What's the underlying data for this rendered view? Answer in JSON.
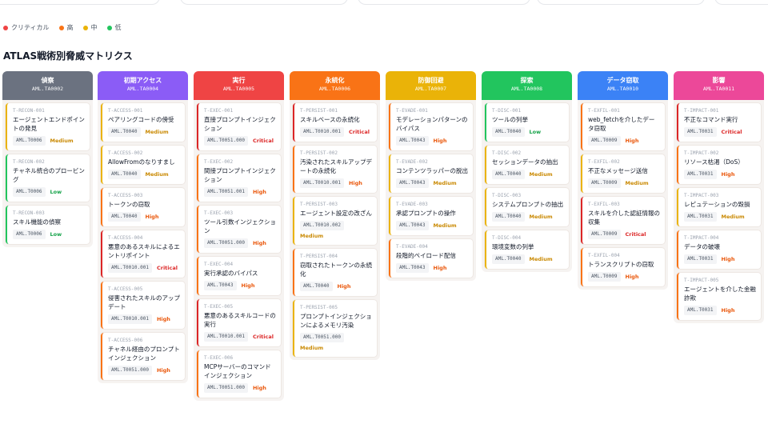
{
  "legend": [
    {
      "label": "クリティカル",
      "color": "#ef4444"
    },
    {
      "label": "高",
      "color": "#f97316"
    },
    {
      "label": "中",
      "color": "#eab308"
    },
    {
      "label": "低",
      "color": "#22c55e"
    }
  ],
  "title": "ATLAS戦術別脅威マトリクス",
  "severity_labels": {
    "critical": "Critical",
    "high": "High",
    "medium": "Medium",
    "low": "Low"
  },
  "severity_colors": {
    "critical": "#dc2626",
    "high": "#f97316",
    "medium": "#eab308",
    "low": "#22c55e"
  },
  "columns": [
    {
      "name": "偵察",
      "id": "AML.TA0002",
      "color": "#6b7280",
      "cards": [
        {
          "tid": "T-RECON-001",
          "name": "エージェントエンドポイントの発見",
          "aml": "AML.T0006",
          "sev": "medium"
        },
        {
          "tid": "T-RECON-002",
          "name": "チャネル統合のプロービング",
          "aml": "AML.T0006",
          "sev": "low"
        },
        {
          "tid": "T-RECON-003",
          "name": "スキル機能の偵察",
          "aml": "AML.T0006",
          "sev": "low"
        }
      ]
    },
    {
      "name": "初期アクセス",
      "id": "AML.TA0004",
      "color": "#8b5cf6",
      "cards": [
        {
          "tid": "T-ACCESS-001",
          "name": "ペアリングコードの傍受",
          "aml": "AML.T0040",
          "sev": "medium"
        },
        {
          "tid": "T-ACCESS-002",
          "name": "AllowFromのなりすまし",
          "aml": "AML.T0040",
          "sev": "medium"
        },
        {
          "tid": "T-ACCESS-003",
          "name": "トークンの窃取",
          "aml": "AML.T0040",
          "sev": "high"
        },
        {
          "tid": "T-ACCESS-004",
          "name": "悪意のあるスキルによるエントリポイント",
          "aml": "AML.T0010.001",
          "sev": "critical",
          "wrap": true
        },
        {
          "tid": "T-ACCESS-005",
          "name": "侵害されたスキルのアップデート",
          "aml": "AML.T0010.001",
          "sev": "high"
        },
        {
          "tid": "T-ACCESS-006",
          "name": "チャネル経由のプロンプトインジェクション",
          "aml": "AML.T0051.000",
          "sev": "high"
        }
      ]
    },
    {
      "name": "実行",
      "id": "AML.TA0005",
      "color": "#ef4444",
      "cards": [
        {
          "tid": "T-EXEC-001",
          "name": "直接プロンプトインジェクション",
          "aml": "AML.T0051.000",
          "sev": "critical",
          "wrap": true
        },
        {
          "tid": "T-EXEC-002",
          "name": "間接プロンプトインジェクション",
          "aml": "AML.T0051.001",
          "sev": "high"
        },
        {
          "tid": "T-EXEC-003",
          "name": "ツール引数インジェクション",
          "aml": "AML.T0051.000",
          "sev": "high"
        },
        {
          "tid": "T-EXEC-004",
          "name": "実行承認のバイパス",
          "aml": "AML.T0043",
          "sev": "high"
        },
        {
          "tid": "T-EXEC-005",
          "name": "悪意のあるスキルコードの実行",
          "aml": "AML.T0010.001",
          "sev": "critical",
          "wrap": true
        },
        {
          "tid": "T-EXEC-006",
          "name": "MCPサーバーのコマンドインジェクション",
          "aml": "AML.T0051.000",
          "sev": "high"
        }
      ]
    },
    {
      "name": "永続化",
      "id": "AML.TA0006",
      "color": "#f97316",
      "cards": [
        {
          "tid": "T-PERSIST-001",
          "name": "スキルベースの永続化",
          "aml": "AML.T0010.001",
          "sev": "critical",
          "wrap": true
        },
        {
          "tid": "T-PERSIST-002",
          "name": "汚染されたスキルアップデートの永続化",
          "aml": "AML.T0010.001",
          "sev": "high"
        },
        {
          "tid": "T-PERSIST-003",
          "name": "エージェント設定の改ざん",
          "aml": "AML.T0010.002",
          "sev": "medium",
          "wrap": true
        },
        {
          "tid": "T-PERSIST-004",
          "name": "窃取されたトークンの永続化",
          "aml": "AML.T0040",
          "sev": "high"
        },
        {
          "tid": "T-PERSIST-005",
          "name": "プロンプトインジェクションによるメモリ汚染",
          "aml": "AML.T0051.000",
          "sev": "medium",
          "wrap": true
        }
      ]
    },
    {
      "name": "防御回避",
      "id": "AML.TA0007",
      "color": "#eab308",
      "cards": [
        {
          "tid": "T-EVADE-001",
          "name": "モデレーションパターンのバイパス",
          "aml": "AML.T0043",
          "sev": "high"
        },
        {
          "tid": "T-EVADE-002",
          "name": "コンテンツラッパーの脱出",
          "aml": "AML.T0043",
          "sev": "medium"
        },
        {
          "tid": "T-EVADE-003",
          "name": "承認プロンプトの操作",
          "aml": "AML.T0043",
          "sev": "medium"
        },
        {
          "tid": "T-EVADE-004",
          "name": "段階的ペイロード配信",
          "aml": "AML.T0043",
          "sev": "high"
        }
      ]
    },
    {
      "name": "探索",
      "id": "AML.TA0008",
      "color": "#22c55e",
      "cards": [
        {
          "tid": "T-DISC-001",
          "name": "ツールの列挙",
          "aml": "AML.T0040",
          "sev": "low"
        },
        {
          "tid": "T-DISC-002",
          "name": "セッションデータの抽出",
          "aml": "AML.T0040",
          "sev": "medium"
        },
        {
          "tid": "T-DISC-003",
          "name": "システムプロンプトの抽出",
          "aml": "AML.T0040",
          "sev": "medium"
        },
        {
          "tid": "T-DISC-004",
          "name": "環境変数の列挙",
          "aml": "AML.T0040",
          "sev": "medium"
        }
      ]
    },
    {
      "name": "データ窃取",
      "id": "AML.TA0010",
      "color": "#3b82f6",
      "cards": [
        {
          "tid": "T-EXFIL-001",
          "name": "web_fetchを介したデータ窃取",
          "aml": "AML.T0009",
          "sev": "high"
        },
        {
          "tid": "T-EXFIL-002",
          "name": "不正なメッセージ送信",
          "aml": "AML.T0009",
          "sev": "medium"
        },
        {
          "tid": "T-EXFIL-003",
          "name": "スキルを介した認証情報の収集",
          "aml": "AML.T0009",
          "sev": "critical"
        },
        {
          "tid": "T-EXFIL-004",
          "name": "トランスクリプトの窃取",
          "aml": "AML.T0009",
          "sev": "high"
        }
      ]
    },
    {
      "name": "影響",
      "id": "AML.TA0011",
      "color": "#ec4899",
      "cards": [
        {
          "tid": "T-IMPACT-001",
          "name": "不正なコマンド実行",
          "aml": "AML.T0031",
          "sev": "critical"
        },
        {
          "tid": "T-IMPACT-002",
          "name": "リソース枯渇（DoS）",
          "aml": "AML.T0031",
          "sev": "high"
        },
        {
          "tid": "T-IMPACT-003",
          "name": "レピュテーションの毀損",
          "aml": "AML.T0031",
          "sev": "medium"
        },
        {
          "tid": "T-IMPACT-004",
          "name": "データの破壊",
          "aml": "AML.T0031",
          "sev": "high"
        },
        {
          "tid": "T-IMPACT-005",
          "name": "エージェントを介した金融詐欺",
          "aml": "AML.T0031",
          "sev": "high"
        }
      ]
    }
  ]
}
